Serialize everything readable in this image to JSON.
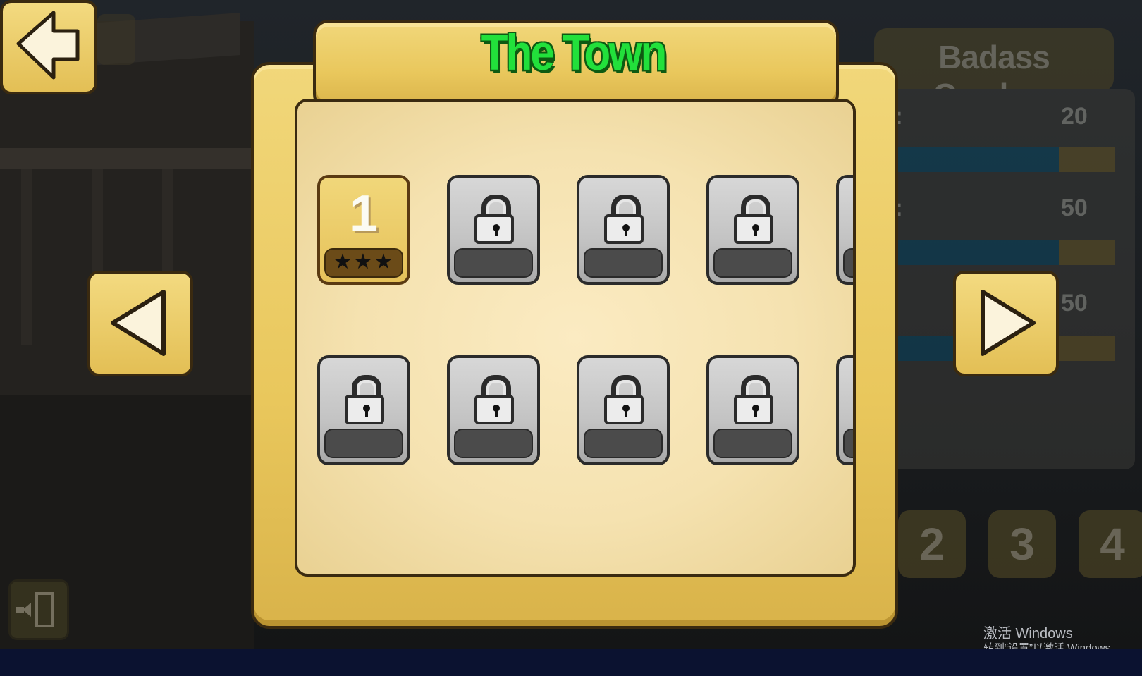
{
  "title": "The Town",
  "side_panel": {
    "header": "Badass Cowboy",
    "stats": [
      {
        "label": "i:",
        "value": "20",
        "fill": 0.82
      },
      {
        "label": "i:",
        "value": "50",
        "fill": 0.82
      },
      {
        "label": ":",
        "value": "50",
        "fill": 0.82
      }
    ],
    "pages": [
      "2",
      "3",
      "4"
    ]
  },
  "levels": [
    {
      "number": "1",
      "locked": false,
      "stars": "★★★"
    },
    {
      "locked": true
    },
    {
      "locked": true
    },
    {
      "locked": true
    },
    {
      "locked": true
    },
    {
      "locked": true
    },
    {
      "locked": true
    },
    {
      "locked": true
    }
  ],
  "buttons": {
    "back": "back-arrow-icon",
    "prev": "triangle-left-icon",
    "next": "triangle-right-icon",
    "exit": "exit-door-icon"
  },
  "watermark": {
    "line1": "激活 Windows",
    "line2": "转到“设置”以激活 Windows。"
  },
  "colors": {
    "title": "#22e03b",
    "wood": "#e9c75c",
    "locked_tile": "#c3c3c3"
  }
}
